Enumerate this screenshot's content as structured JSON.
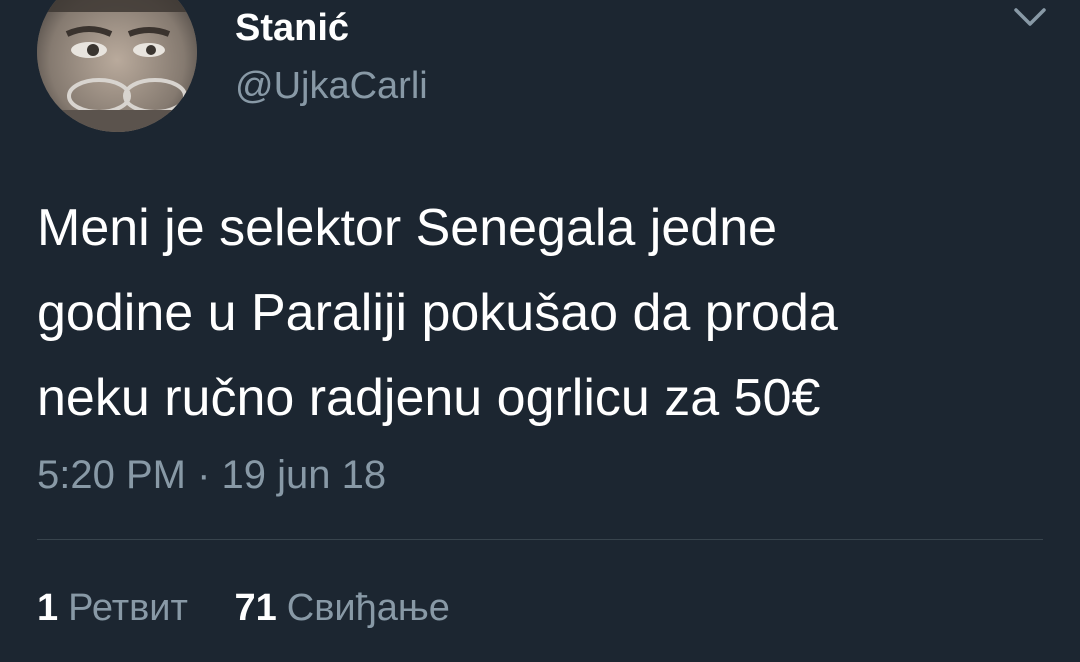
{
  "user": {
    "display_name": "Stanić",
    "handle": "@UjkaCarli"
  },
  "tweet": {
    "lines": [
      "Meni je selektor Senegala jedne",
      "godine u Paraliji pokušao da proda",
      "neku ručno radjenu ogrlicu za 50€"
    ],
    "time": "5:20 PM",
    "separator": "·",
    "date": "19 jun 18"
  },
  "stats": {
    "retweets_count": "1",
    "retweets_label": "Ретвит",
    "likes_count": "71",
    "likes_label": "Свиђање"
  },
  "icons": {
    "menu": "chevron-down-icon"
  },
  "colors": {
    "background": "#1c2631",
    "primary_text": "#ffffff",
    "secondary_text": "#8899a6",
    "divider": "#38444d"
  }
}
